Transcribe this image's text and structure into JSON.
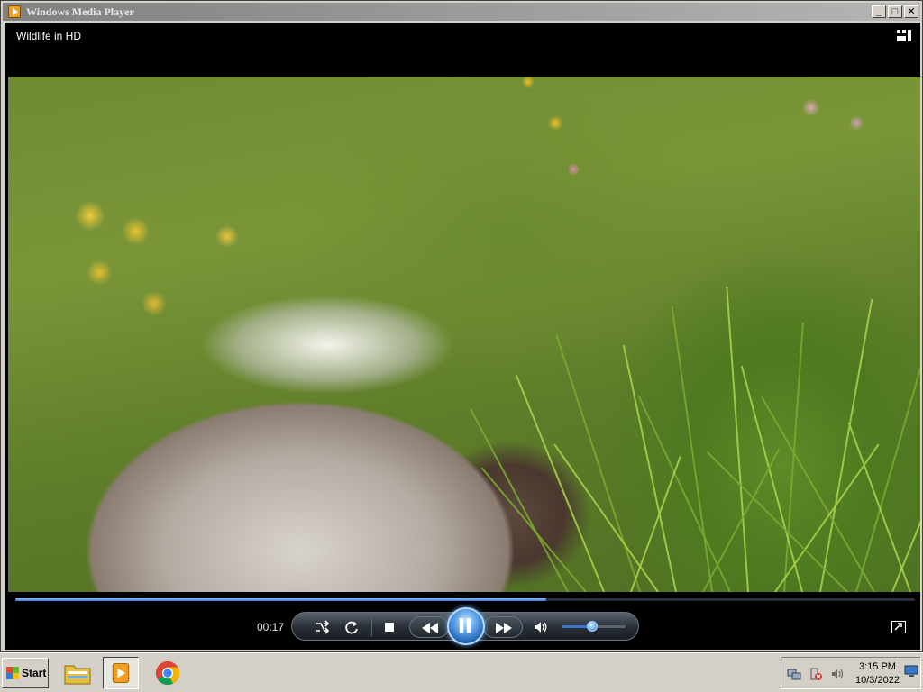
{
  "window": {
    "title": "Windows Media Player",
    "buttons": {
      "minimize": "_",
      "maximize": "□",
      "close": "✕"
    }
  },
  "player": {
    "media_title": "Wildlife in HD",
    "elapsed_time": "00:17",
    "seek_progress_fraction": 0.59,
    "volume_fraction": 0.47,
    "state": "playing"
  },
  "icons": {
    "app": "wmp-icon",
    "switch_to_library": "switch-to-library-icon",
    "shuffle": "shuffle-icon",
    "repeat": "repeat-icon",
    "stop": "stop-icon",
    "previous": "previous-icon",
    "pause": "pause-icon",
    "next": "next-icon",
    "mute": "speaker-icon",
    "fullscreen": "fullscreen-icon"
  },
  "taskbar": {
    "start_label": "Start",
    "clock_time": "3:15 PM",
    "clock_date": "10/3/2022",
    "apps": [
      "file-explorer",
      "windows-media-player",
      "google-chrome"
    ]
  },
  "colors": {
    "accent_blue": "#3a78d0",
    "desktop": "#3a6ea5",
    "chrome_gray": "#d4d0c8"
  }
}
